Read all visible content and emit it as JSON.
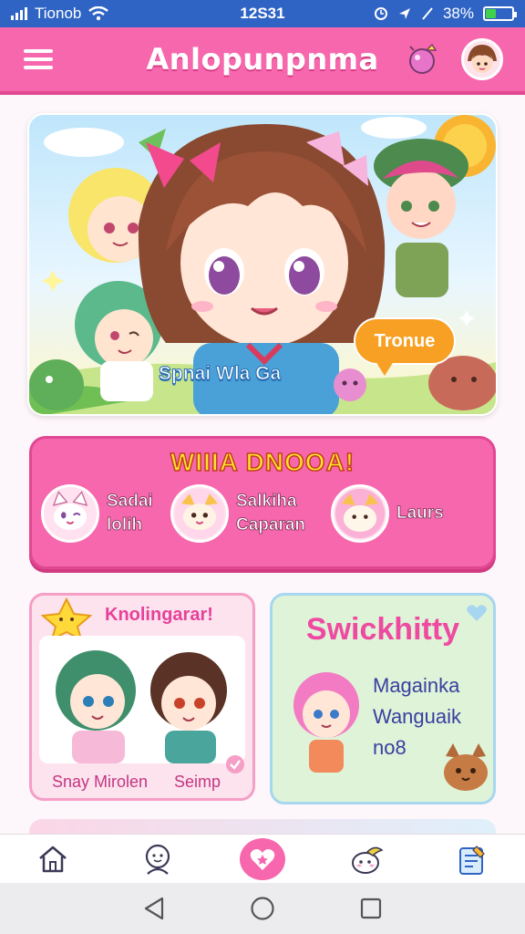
{
  "status_bar": {
    "carrier": "Tionob",
    "time": "12S31",
    "battery": "38%"
  },
  "app_bar": {
    "title": "Anlopunpnma"
  },
  "hero": {
    "caption": "Spnai Wla Ga",
    "speech_bubble": "Tronue"
  },
  "promo": {
    "title": "WIIIA DNOOA!",
    "friends": [
      {
        "line1": "Sadai",
        "line2": "lolih"
      },
      {
        "line1": "Salkiha",
        "line2": "Caparan"
      },
      {
        "line1": "Laurs",
        "line2": ""
      }
    ]
  },
  "card_left": {
    "title": "Knolingarar!",
    "captions": [
      "Snay Mirolen",
      "Seimp"
    ]
  },
  "card_right": {
    "title": "Swickhitty",
    "lines": [
      "Magainka",
      "Wanguaik",
      "no8"
    ]
  },
  "colors": {
    "status_bar": "#2f64c4",
    "app_bar": "#f767ad",
    "accent_yellow": "#ffe12e"
  },
  "bottom_nav": [
    "home-icon",
    "profile-icon",
    "heart-icon",
    "pet-icon",
    "notes-icon"
  ]
}
